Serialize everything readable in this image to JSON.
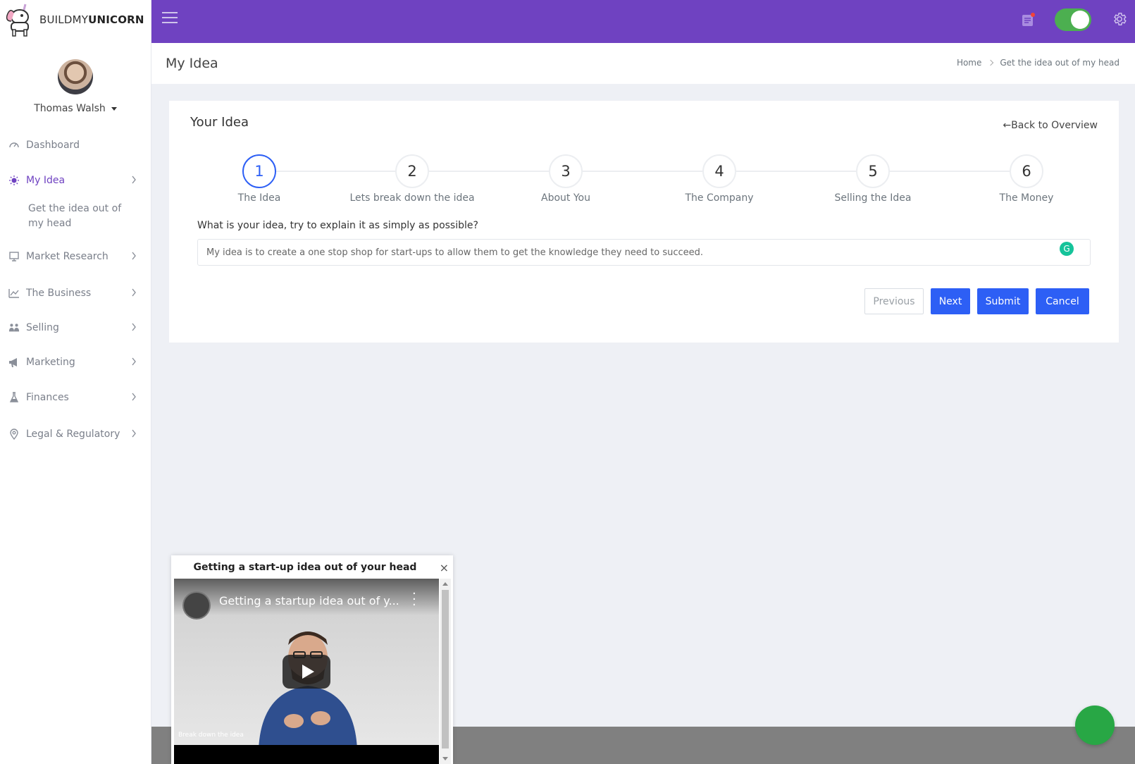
{
  "brand": {
    "prefix": "BUILDMY",
    "bold": "UNICORN"
  },
  "user": {
    "name": "Thomas Walsh"
  },
  "sidebar": {
    "items": [
      {
        "label": "Dashboard",
        "icon": "gauge-icon"
      },
      {
        "label": "My Idea",
        "icon": "lightbulb-icon",
        "active": true
      },
      {
        "label": "Market Research",
        "icon": "presentation-icon"
      },
      {
        "label": "The Business",
        "icon": "chart-line-icon"
      },
      {
        "label": "Selling",
        "icon": "users-icon"
      },
      {
        "label": "Marketing",
        "icon": "megaphone-icon"
      },
      {
        "label": "Finances",
        "icon": "flask-icon"
      },
      {
        "label": "Legal & Regulatory",
        "icon": "map-pin-icon"
      }
    ],
    "subitem": "Get the idea out of my head"
  },
  "header": {
    "title": "My Idea",
    "breadcrumb": [
      "Home",
      "Get the idea out of my head"
    ]
  },
  "card": {
    "title": "Your Idea",
    "back_link": "Back to Overview",
    "steps": [
      {
        "num": "1",
        "label": "The Idea"
      },
      {
        "num": "2",
        "label": "Lets break down the idea"
      },
      {
        "num": "3",
        "label": "About You"
      },
      {
        "num": "4",
        "label": "The Company"
      },
      {
        "num": "5",
        "label": "Selling the Idea"
      },
      {
        "num": "6",
        "label": "The Money"
      }
    ],
    "active_step": 1,
    "question": "What is your idea, try to explain it as simply as possible?",
    "answer": "My idea is to create a one stop shop for start-ups to allow them to get the knowledge they need to succeed.",
    "buttons": {
      "previous": "Previous",
      "next": "Next",
      "submit": "Submit",
      "cancel": "Cancel"
    }
  },
  "popup": {
    "title": "Getting a start-up idea out of your head",
    "close": "×",
    "video_title": "Getting a startup idea out of y...",
    "video_caption": "Break down the idea"
  },
  "colors": {
    "topbar": "#6f42c1",
    "primary": "#2d5ff5",
    "toggle": "#4caf50",
    "chat": "#28a745"
  }
}
